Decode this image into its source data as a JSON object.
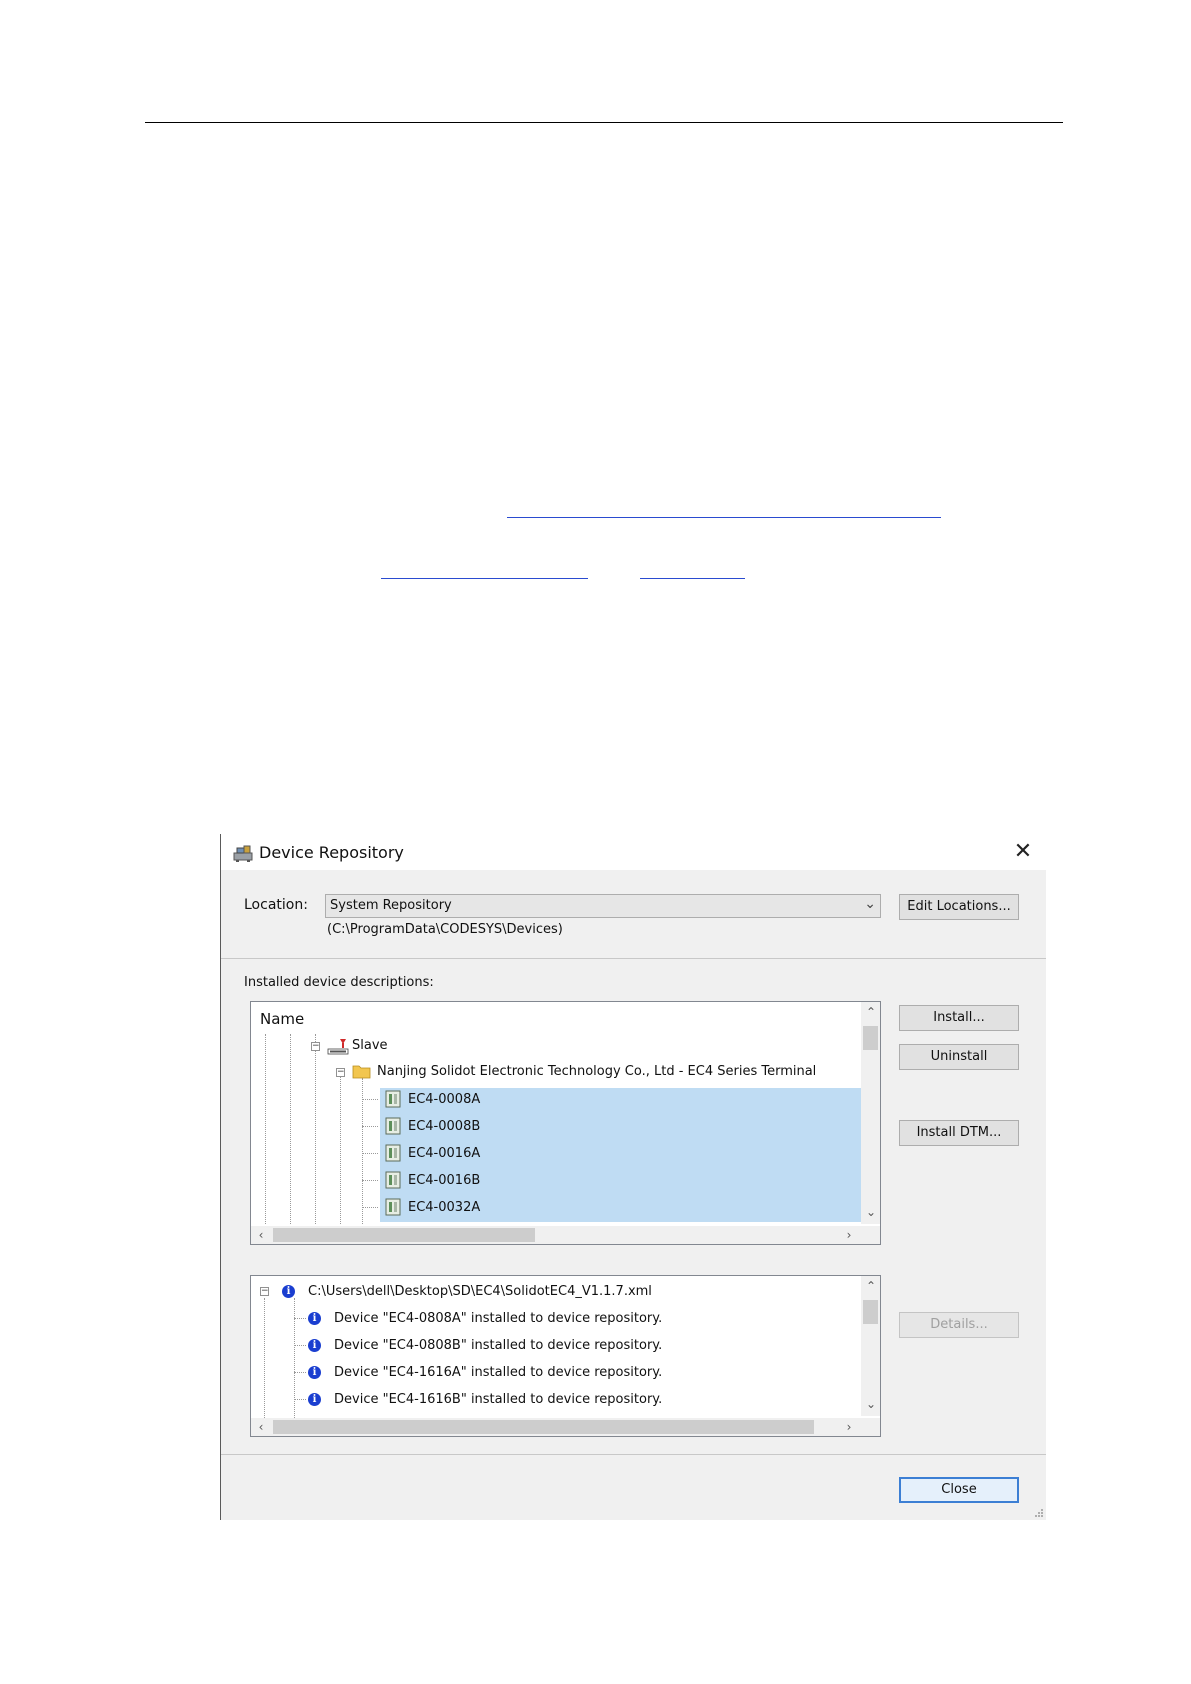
{
  "dialog": {
    "title": "Device Repository",
    "close_glyph": "✕",
    "location_label": "Location:",
    "location_value": "System Repository",
    "location_path": "(C:\\ProgramData\\CODESYS\\Devices)",
    "edit_locations_label": "Edit Locations...",
    "installed_label": "Installed device descriptions:",
    "install_label": "Install...",
    "uninstall_label": "Uninstall",
    "install_dtm_label": "Install DTM...",
    "details_label": "Details...",
    "close_label": "Close"
  },
  "tree": {
    "header": "Name",
    "slave": {
      "icon": "ethercat-slave-icon",
      "label": "Slave"
    },
    "vendor": {
      "icon": "folder-icon",
      "label": "Nanjing Solidot Electronic Technology Co., Ltd - EC4 Series Terminal"
    },
    "devices": [
      {
        "label": "EC4-0008A"
      },
      {
        "label": "EC4-0008B"
      },
      {
        "label": "EC4-0016A"
      },
      {
        "label": "EC4-0016B"
      },
      {
        "label": "EC4-0032A"
      }
    ]
  },
  "log": {
    "file": "C:\\Users\\dell\\Desktop\\SD\\EC4\\SolidotEC4_V1.1.7.xml",
    "entries": [
      {
        "text": "Device \"EC4-0808A\" installed to device repository."
      },
      {
        "text": "Device \"EC4-0808B\" installed to device repository."
      },
      {
        "text": "Device \"EC4-1616A\" installed to device repository."
      },
      {
        "text": "Device \"EC4-1616B\" installed to device repository."
      }
    ]
  },
  "colors": {
    "selection": "#bfdcf3",
    "info_icon": "#1a3ed0",
    "link_underline": "#2a4bd0"
  }
}
